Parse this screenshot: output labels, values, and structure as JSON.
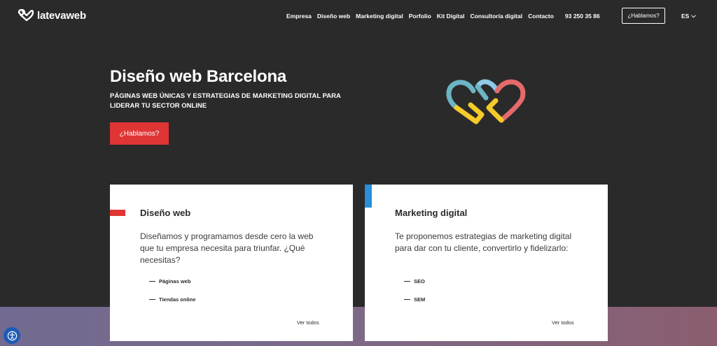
{
  "header": {
    "logo_text": "latevaweb",
    "menu": [
      {
        "label": "Empresa"
      },
      {
        "label": "Diseño web"
      },
      {
        "label": "Marketing digital"
      },
      {
        "label": "Porfolio"
      },
      {
        "label": "Kit Digital"
      },
      {
        "label": "Consultoría digital"
      },
      {
        "label": "Contacto"
      }
    ],
    "phone": "93 250 35 86",
    "cta_label": "¿Hablamos?",
    "language": "ES"
  },
  "hero": {
    "title": "Diseño web Barcelona",
    "subtitle": "PÁGINAS WEB ÚNICAS Y ESTRATEGIAS DE MARKETING DIGITAL PARA LIDERAR TU SECTOR ONLINE",
    "cta_label": "¿Hablamos?"
  },
  "cards": [
    {
      "title": "Diseño web",
      "description": "Diseñamos y programamos desde cero la web que tu empresa necesita para triunfar. ¿Qué necesitas?",
      "items": [
        "Páginas web",
        "Tiendas online"
      ],
      "link": "Ver todos",
      "accent": "#e03535"
    },
    {
      "title": "Marketing digital",
      "description": "Te proponemos estrategias de marketing digital para dar con tu cliente, convertirlo y fidelizarlo:",
      "items": [
        "SEO",
        "SEM"
      ],
      "link": "Ver todos",
      "accent": "#2a8ed8"
    }
  ],
  "icons": {
    "logo": "double-heart-icon",
    "language_toggle": "chevron-down-icon",
    "accessibility": "accessibility-icon"
  },
  "colors": {
    "background": "#2b2a2b",
    "primary_red": "#e03535",
    "accent_blue": "#2a8ed8",
    "logo_teal": "#6bb5c4",
    "logo_yellow": "#f5cb2a",
    "logo_coral": "#e56a6a",
    "logo_sky": "#8fcbe8"
  }
}
